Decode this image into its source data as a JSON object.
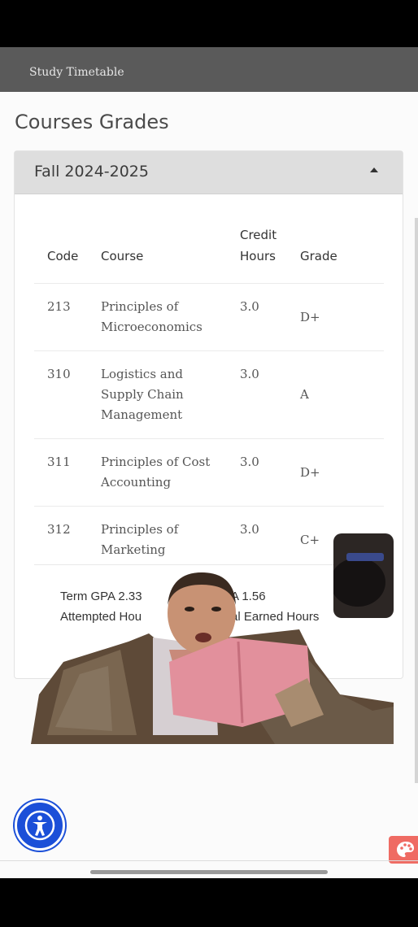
{
  "header": {
    "title": "Study Timetable"
  },
  "page": {
    "title": "Courses Grades"
  },
  "term": {
    "label": "Fall  2024-2025",
    "columns": {
      "code": "Code",
      "course": "Course",
      "credit_hours": "Credit Hours",
      "grade": "Grade"
    },
    "rows": [
      {
        "code": "213",
        "course": "Principles of Microeconomics",
        "credit_hours": "3.0",
        "grade": "D+"
      },
      {
        "code": "310",
        "course": "Logistics and Supply Chain Management",
        "credit_hours": "3.0",
        "grade": "A"
      },
      {
        "code": "311",
        "course": "Principles of Cost Accounting",
        "credit_hours": "3.0",
        "grade": "D+"
      },
      {
        "code": "312",
        "course": "Principles of Marketing",
        "credit_hours": "3.0",
        "grade": "C+"
      }
    ],
    "summary": {
      "term_gpa": "Term GPA 2.33",
      "cumulative_gpa": "A 1.56",
      "attempted_hours": "Attempted Hou",
      "earned_hours": "al Earned Hours"
    }
  },
  "icons": {
    "accessibility": "accessibility-icon",
    "palette": "palette-icon",
    "collapse": "chevron-up-icon"
  },
  "colors": {
    "topbar": "#5a5a5a",
    "accessibility_button": "#1b4fd8",
    "palette_button": "#ef6b63"
  }
}
